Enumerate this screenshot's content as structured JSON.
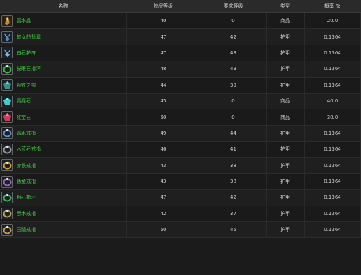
{
  "headers": {
    "name": "名称",
    "item_level": "物品等级",
    "req_level": "要求等级",
    "type": "类型",
    "rate": "概率 %"
  },
  "rows": [
    {
      "name": "富水晶",
      "item_level": "40",
      "req_level": "0",
      "type": "商品",
      "rate": "20.0",
      "icon": "crystal-icon",
      "color": "#c58a3a"
    },
    {
      "name": "虹女的翡翠",
      "item_level": "47",
      "req_level": "42",
      "type": "护甲",
      "rate": "0.1364",
      "icon": "amulet-icon",
      "color": "#4a8ad6"
    },
    {
      "name": "白石护符",
      "item_level": "47",
      "req_level": "43",
      "type": "护甲",
      "rate": "0.1364",
      "icon": "amulet-icon",
      "color": "#7ab7e8"
    },
    {
      "name": "猫眼石指环",
      "item_level": "48",
      "req_level": "43",
      "type": "护甲",
      "rate": "0.1364",
      "icon": "ring-icon",
      "color": "#45b845"
    },
    {
      "name": "钢铁之钩",
      "item_level": "44",
      "req_level": "39",
      "type": "护甲",
      "rate": "0.1364",
      "icon": "gem-icon",
      "color": "#3a8f8a"
    },
    {
      "name": "青绿石",
      "item_level": "45",
      "req_level": "0",
      "type": "商品",
      "rate": "40.0",
      "icon": "gem-icon",
      "color": "#45c9c9"
    },
    {
      "name": "红宝石",
      "item_level": "50",
      "req_level": "0",
      "type": "商品",
      "rate": "30.0",
      "icon": "gem-icon",
      "color": "#d23a5a"
    },
    {
      "name": "富水戒指",
      "item_level": "49",
      "req_level": "44",
      "type": "护甲",
      "rate": "0.1364",
      "icon": "ring-icon",
      "color": "#6a8fc9"
    },
    {
      "name": "水蓝石戒指",
      "item_level": "46",
      "req_level": "41",
      "type": "护甲",
      "rate": "0.1364",
      "icon": "ring-icon",
      "color": "#9a9a9a"
    },
    {
      "name": "赤铁戒指",
      "item_level": "43",
      "req_level": "38",
      "type": "护甲",
      "rate": "0.1364",
      "icon": "ring-icon",
      "color": "#d0a22a"
    },
    {
      "name": "钛金戒指",
      "item_level": "43",
      "req_level": "38",
      "type": "护甲",
      "rate": "0.1364",
      "icon": "ring-icon",
      "color": "#9a6ac9"
    },
    {
      "name": "银石指环",
      "item_level": "47",
      "req_level": "42",
      "type": "护甲",
      "rate": "0.1364",
      "icon": "ring-icon",
      "color": "#3ab85a"
    },
    {
      "name": "黑木戒指",
      "item_level": "42",
      "req_level": "37",
      "type": "护甲",
      "rate": "0.1364",
      "icon": "ring-icon",
      "color": "#b8a35a"
    },
    {
      "name": "玉髓戒指",
      "item_level": "50",
      "req_level": "45",
      "type": "护甲",
      "rate": "0.1364",
      "icon": "ring-icon",
      "color": "#c9a04a"
    }
  ]
}
